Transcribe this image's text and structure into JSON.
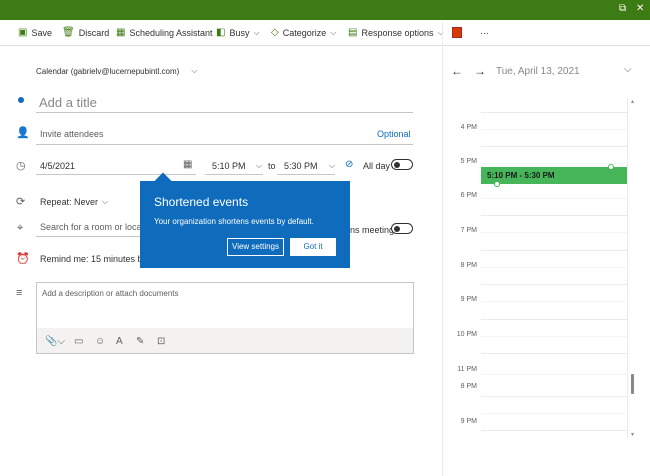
{
  "toolbar": {
    "save": "Save",
    "discard": "Discard",
    "scheduling": "Scheduling Assistant",
    "busy": "Busy",
    "categorize": "Categorize",
    "response": "Response options",
    "more": "···"
  },
  "calendar_label": "Calendar (gabrielv@lucernepubintl.com)",
  "title_placeholder": "Add a title",
  "attendees_placeholder": "Invite attendees",
  "optional_label": "Optional",
  "start_date": "4/5/2021",
  "start_time": "5:10 PM",
  "to_label": "to",
  "end_time": "5:30 PM",
  "allday_label": "All day",
  "repeat_label": "Repeat: Never",
  "location_placeholder": "Search for a room or location",
  "teams_partial": "ns meeting",
  "remind_label": "Remind me: 15 minutes before",
  "description_placeholder": "Add a description or attach documents",
  "popup": {
    "title": "Shortened events",
    "text": "Your organization shortens events by default.",
    "view_settings": "View settings",
    "got_it": "Got it"
  },
  "day_view": {
    "date": "Tue, April 13, 2021",
    "hours": [
      "4 PM",
      "5 PM",
      "6 PM",
      "7 PM",
      "8 PM",
      "9 PM",
      "10 PM",
      "11 PM"
    ],
    "hours_lower": [
      "8 PM",
      "9 PM"
    ],
    "event_label": "5:10 PM - 5:30 PM"
  },
  "colors": {
    "brand_green": "#3d7b14",
    "accent_blue": "#0f6cbd",
    "event_green": "#47b55a"
  }
}
